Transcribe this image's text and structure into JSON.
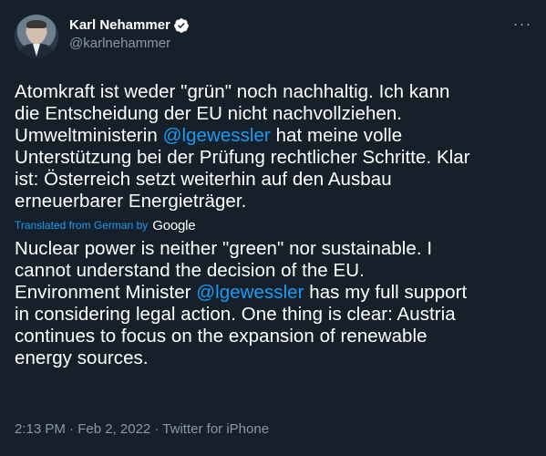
{
  "author": {
    "display_name": "Karl Nehammer",
    "handle": "@karlnehammer"
  },
  "more_label": "···",
  "original_text": {
    "lines": [
      [
        "Atomkraft ist weder \"grün\" noch nachhaltig. Ich kann"
      ],
      [
        "die Entscheidung der EU nicht nachvollziehen."
      ],
      [
        "Umweltministerin ",
        "@lgewessler",
        " hat meine volle"
      ],
      [
        "Unterstützung bei der Prüfung rechtlicher Schritte. Klar"
      ],
      [
        "ist: Österreich setzt weiterhin auf den Ausbau"
      ],
      [
        "erneuerbarer Energieträger."
      ]
    ]
  },
  "translation": {
    "label": "Translated from German by",
    "provider": "Google",
    "lines": [
      [
        "Nuclear power is neither \"green\" nor sustainable. I"
      ],
      [
        "cannot understand the decision of the EU."
      ],
      [
        "Environment Minister ",
        "@lgewessler",
        " has my full support"
      ],
      [
        "in considering legal action. One thing is clear: Austria"
      ],
      [
        "continues to focus on the expansion of renewable"
      ],
      [
        "energy sources."
      ]
    ]
  },
  "meta": "2:13 PM · Feb 2, 2022 · Twitter for iPhone",
  "colors": {
    "background": "#15202b",
    "text": "#ffffff",
    "secondary": "#8b98a5",
    "link": "#1d9bf0"
  }
}
